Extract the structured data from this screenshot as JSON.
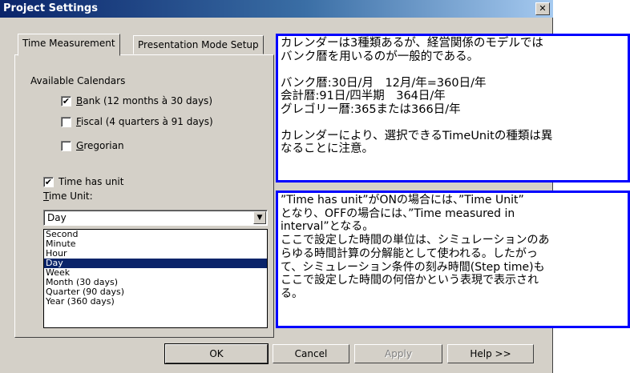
{
  "window": {
    "title": "Project Settings",
    "close_glyph": "✕"
  },
  "tabs": [
    {
      "label": "Time Measurement",
      "active": true
    },
    {
      "label": "Presentation Mode Setup",
      "active": false
    }
  ],
  "calendars": {
    "legend": "Available Calendars",
    "items": [
      {
        "label": "Bank (12 months à 30 days)",
        "checked": true
      },
      {
        "label": "Fiscal (4 quarters à 91 days)",
        "checked": false
      },
      {
        "label": "Gregorian",
        "checked": false
      }
    ]
  },
  "time_has_unit": {
    "label": "Time has unit",
    "checked": true
  },
  "time_unit": {
    "label": "Time Unit:",
    "value": "Day",
    "options": [
      "Second",
      "Minute",
      "Hour",
      "Day",
      "Week",
      "Month (30 days)",
      "Quarter (90 days)",
      "Year (360 days)"
    ],
    "selected_index": 3
  },
  "buttons": {
    "ok": "OK",
    "cancel": "Cancel",
    "apply": "Apply",
    "help": "Help >>"
  },
  "notes": {
    "note1": "カレンダーは3種類あるが、経営関係のモデルでは\nバンク暦を用いるのが一般的である。\n\nバンク暦:30日/月　12月/年=360日/年\n会計暦:91日/四半期　364日/年\nグレゴリー暦:365または366日/年\n\nカレンダーにより、選択できるTimeUnitの種類は異\nなることに注意。",
    "note2": "”Time has unit”がONの場合には、”Time Unit”\nとなり、OFFの場合には、”Time measured in\ninterval”となる。\nここで設定した時間の単位は、シミュレーションのあ\nらゆる時間計算の分解能として使われる。したがっ\nて、シミュレーション条件の刻み時間(Step time)も\nここで設定した時間の何倍かという表現で表示され\nる。"
  },
  "colors": {
    "title_bar": "#0a246a",
    "selection": "#0a246a",
    "note_border": "#0000ff",
    "dialog_face": "#d4d0c8"
  }
}
